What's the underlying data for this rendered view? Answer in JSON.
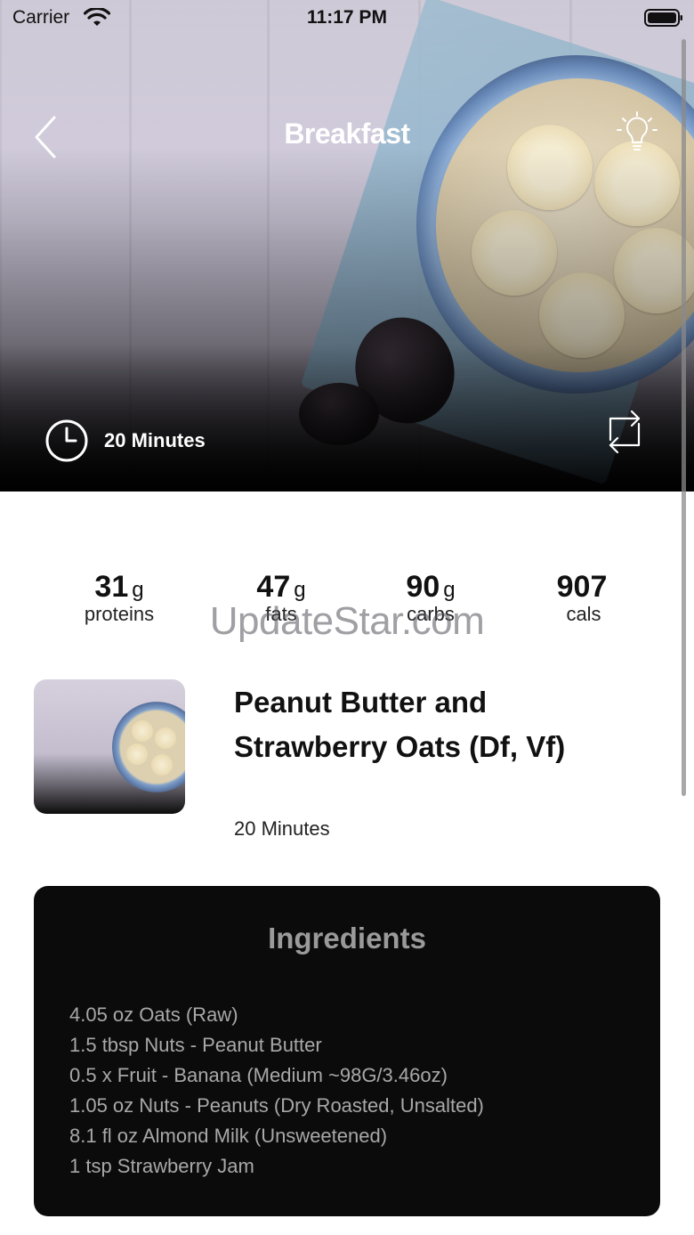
{
  "status_bar": {
    "carrier": "Carrier",
    "time": "11:17 PM"
  },
  "header": {
    "title": "Breakfast"
  },
  "hero": {
    "duration": "20 Minutes"
  },
  "macros": [
    {
      "value": "31",
      "unit": "g",
      "label": "proteins"
    },
    {
      "value": "47",
      "unit": "g",
      "label": "fats"
    },
    {
      "value": "90",
      "unit": "g",
      "label": "carbs"
    },
    {
      "value": "907",
      "unit": "",
      "label": "cals"
    }
  ],
  "watermark": "UpdateStar.com",
  "recipe": {
    "title": "Peanut Butter and Strawberry Oats (Df, Vf)",
    "duration": "20 Minutes"
  },
  "ingredients": {
    "title": "Ingredients",
    "items": [
      "4.05 oz Oats (Raw)",
      "1.5 tbsp Nuts - Peanut Butter",
      "0.5 x Fruit - Banana (Medium ~98G/3.46oz)",
      "1.05 oz Nuts - Peanuts (Dry Roasted, Unsalted)",
      "8.1 fl oz Almond Milk (Unsweetened)",
      "1 tsp Strawberry Jam"
    ]
  },
  "icons": {
    "back": "chevron-left-icon",
    "tip": "lightbulb-icon",
    "time": "clock-icon",
    "swap": "swap-arrows-icon",
    "wifi": "wifi-icon",
    "battery": "battery-icon"
  }
}
